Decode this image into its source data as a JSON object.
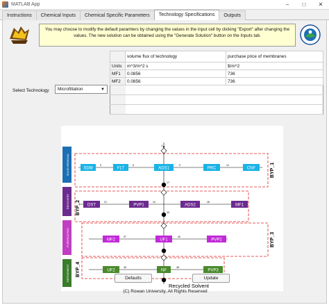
{
  "window": {
    "title": "MATLAB App"
  },
  "window_controls": {
    "minimize": "–",
    "maximize": "□",
    "close": "✕"
  },
  "tabs": [
    {
      "label": "Instructions"
    },
    {
      "label": "Chemical Inputs"
    },
    {
      "label": "Chemical Specific Parameters"
    },
    {
      "label": "Technology Specifications"
    },
    {
      "label": "Outputs"
    }
  ],
  "banner": {
    "text": "You may choose to modify the default paramters by changing the values in the input cell by clicking \"Export\" after changing the values. The new solution can be obtained using the \"Generate Solution\" button on the Inputs tab."
  },
  "table": {
    "headers": [
      "",
      "volume flux of technology",
      "purchase price of membranes"
    ],
    "rows": [
      [
        "Units",
        "m^3/m^2 s",
        "$/m^2"
      ],
      [
        "MF1",
        "0.0856",
        "736"
      ],
      [
        "MF2",
        "0.0856",
        "736"
      ]
    ]
  },
  "select": {
    "label": "Select Technology",
    "value": "Microfiltation",
    "arrow": "▼"
  },
  "diagram": {
    "input_label": "1",
    "output_label": "Recycled Solvent",
    "sections": [
      {
        "label": "SOLID REMOVAL",
        "color": "#1b6fb3"
      },
      {
        "label": "RECOVERY",
        "color": "#6c2b8f"
      },
      {
        "label": "PURIFICATION",
        "color": "#c03ec2"
      },
      {
        "label": "REFINEMENT",
        "color": "#3a7d2b"
      }
    ],
    "byp_labels": [
      "BYP_1",
      "BYP_2",
      "BYP_3",
      "BYP_4"
    ],
    "units_row1": [
      "SDM",
      "FLT",
      "ADS1",
      "PRC",
      "CNF"
    ],
    "units_row2": [
      "DST",
      "PVP1",
      "ADS2",
      "MF1"
    ],
    "units_row3": [
      "MF2",
      "UF1",
      "PVP2"
    ],
    "units_row4": [
      "UF2",
      "NF",
      "PVP3"
    ],
    "colors": {
      "row1": "#1ab3e6",
      "row2": "#6c2b8f",
      "row3": "#c02ad8",
      "row4": "#4a8a2c"
    },
    "streams": [
      "2",
      "3",
      "4",
      "5",
      "6",
      "7",
      "8",
      "9",
      "10",
      "11",
      "12",
      "13",
      "14",
      "15",
      "16",
      "17",
      "18",
      "19",
      "20",
      "21",
      "22",
      "23",
      "24",
      "25",
      "26",
      "27",
      "28",
      "29",
      "30",
      "31",
      "32",
      "33",
      "34",
      "35",
      "36",
      "37",
      "38",
      "39",
      "40",
      "41",
      "42",
      "43",
      "44",
      "45",
      "46",
      "47",
      "48",
      "49",
      "50"
    ]
  },
  "buttons": {
    "defaults": "Defaults",
    "update": "Update"
  },
  "footer": {
    "text": "(C) Rowan University, All Rights Reserved"
  }
}
